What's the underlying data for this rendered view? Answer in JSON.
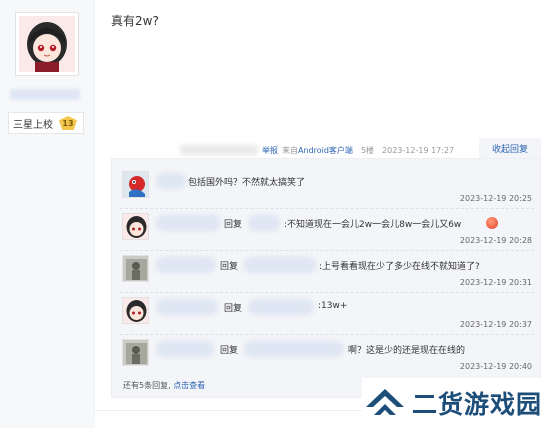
{
  "author": {
    "level_label": "三星上校",
    "level_number": "13"
  },
  "post": {
    "text": "真有2w?"
  },
  "meta": {
    "report": "举报",
    "from_prefix": "来自",
    "from_client": "Android客户端",
    "floor": "5楼",
    "date": "2023-12-19 17:27",
    "collapse_label": "收起回复"
  },
  "replies": [
    {
      "text": "包括国外吗？不然就太搞笑了",
      "time": "2023-12-19 20:25"
    },
    {
      "reply_label": "回复",
      "text": ":不知道现在一会儿2w一会儿8w一会儿又6w",
      "time": "2023-12-19 20:28"
    },
    {
      "reply_label": "回复",
      "text": ":上号看看现在少了多少在线不就知道了?",
      "time": "2023-12-19 20:31"
    },
    {
      "reply_label": "回复",
      "text": ":13w+",
      "time": "2023-12-19 20:37"
    },
    {
      "reply_label": "回复",
      "text": "啊？这是少的还是现在在线的",
      "time": "2023-12-19 20:40"
    }
  ],
  "more": {
    "prefix": "还有5条回复,",
    "link": "点击查看"
  },
  "watermark": {
    "text": "二货游戏园"
  },
  "colors": {
    "link": "#2d64b3",
    "reply_bg": "#f3f5f8",
    "watermark": "#1d4e7a"
  }
}
